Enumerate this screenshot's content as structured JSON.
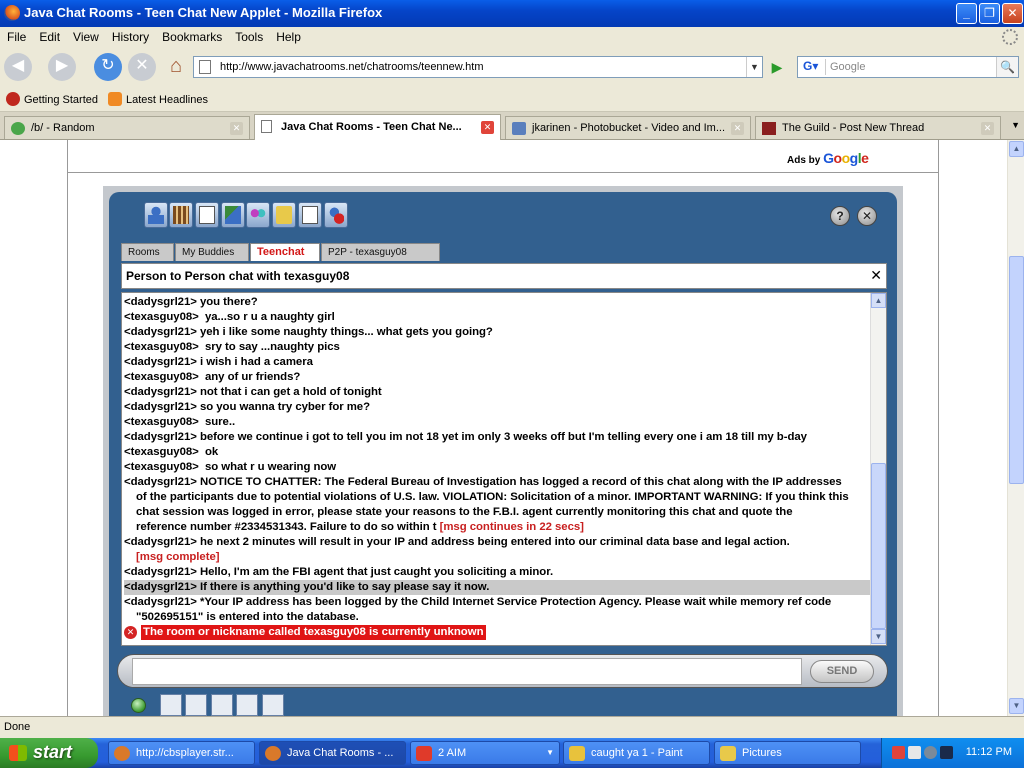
{
  "window": {
    "title": "Java Chat Rooms - Teen Chat New Applet - Mozilla Firefox"
  },
  "menu": [
    "File",
    "Edit",
    "View",
    "History",
    "Bookmarks",
    "Tools",
    "Help"
  ],
  "nav": {
    "url": "http://www.javachatrooms.net/chatrooms/teennew.htm",
    "search_placeholder": "Google"
  },
  "bookmarks": [
    "Getting Started",
    "Latest Headlines"
  ],
  "tabs": [
    {
      "label": "/b/ - Random",
      "active": false
    },
    {
      "label": "Java Chat Rooms - Teen Chat Ne...",
      "active": true
    },
    {
      "label": "jkarinen - Photobucket - Video and Im...",
      "active": false
    },
    {
      "label": "The Guild - Post New Thread",
      "active": false
    }
  ],
  "ads": {
    "prefix": "Ads by",
    "brand": "Google"
  },
  "applet": {
    "tabs": [
      "Rooms",
      "My Buddies",
      "Teenchat",
      "P2P - texasguy08"
    ],
    "active_tab": "Teenchat",
    "p2p_title": "Person to Person chat with texasguy08",
    "send_label": "SEND",
    "messages": [
      {
        "text": "<dadysgrl21> you there?"
      },
      {
        "text": "<texasguy08>  ya...so r u a naughty girl"
      },
      {
        "text": "<dadysgrl21> yeh i like some naughty things... what gets you going?"
      },
      {
        "text": "<texasguy08>  sry to say ...naughty pics"
      },
      {
        "text": "<dadysgrl21> i wish i had a camera"
      },
      {
        "text": "<texasguy08>  any of ur friends?"
      },
      {
        "text": "<dadysgrl21> not that i can get a hold of tonight"
      },
      {
        "text": "<dadysgrl21> so you wanna try cyber for me?"
      },
      {
        "text": "<texasguy08>  sure.."
      },
      {
        "text": "<dadysgrl21> before we continue i got to tell you im not 18 yet im only 3 weeks off but I'm telling every one i am 18 till my b-day"
      },
      {
        "text": "<texasguy08>  ok"
      },
      {
        "text": "<texasguy08>  so what r u wearing now"
      },
      {
        "text": "<dadysgrl21> NOTICE TO CHATTER: The Federal Bureau of Investigation has logged a record of this chat along with the IP addresses"
      },
      {
        "text": "of the participants due to potential violations of U.S. law. VIOLATION: Solicitation of a minor. IMPORTANT WARNING: If you think this",
        "cont": true
      },
      {
        "text": "chat session was logged in error, please state your reasons to the F.B.I. agent currently monitoring this chat and quote the",
        "cont": true
      },
      {
        "text": "reference number #2334531343. Failure to do so within t ",
        "warn": "[msg continues in 22 secs]",
        "cont": true
      },
      {
        "text": "<dadysgrl21> he next 2 minutes will result in your IP and address being entered into our criminal data base and legal action."
      },
      {
        "text": "",
        "warn": "[msg complete]",
        "cont": true
      },
      {
        "text": "<dadysgrl21> Hello, I'm am the FBI agent that just caught you soliciting a minor."
      },
      {
        "text": "<dadysgrl21> If there is anything you'd like to say please say it now.",
        "highlight": true
      },
      {
        "text": "<dadysgrl21> *Your IP address has been logged by the Child Internet Service Protection Agency. Please wait while memory ref code"
      },
      {
        "text": "\"502695151\" is entered into the database.",
        "cont": true
      }
    ],
    "error": "The room or nickname called texasguy08 is currently unknown"
  },
  "status": "Done",
  "taskbar": {
    "start": "start",
    "items": [
      {
        "label": "http://cbsplayer.str...",
        "color": "#d9792a"
      },
      {
        "label": "Java Chat Rooms - ...",
        "color": "#d9792a",
        "active": true
      },
      {
        "label": "2 AIM",
        "color": "#e03a2a",
        "dropdown": true
      },
      {
        "label": "caught ya 1 - Paint",
        "color": "#e8c23c"
      },
      {
        "label": "Pictures",
        "color": "#e8c94a"
      }
    ],
    "clock": "11:12 PM"
  }
}
